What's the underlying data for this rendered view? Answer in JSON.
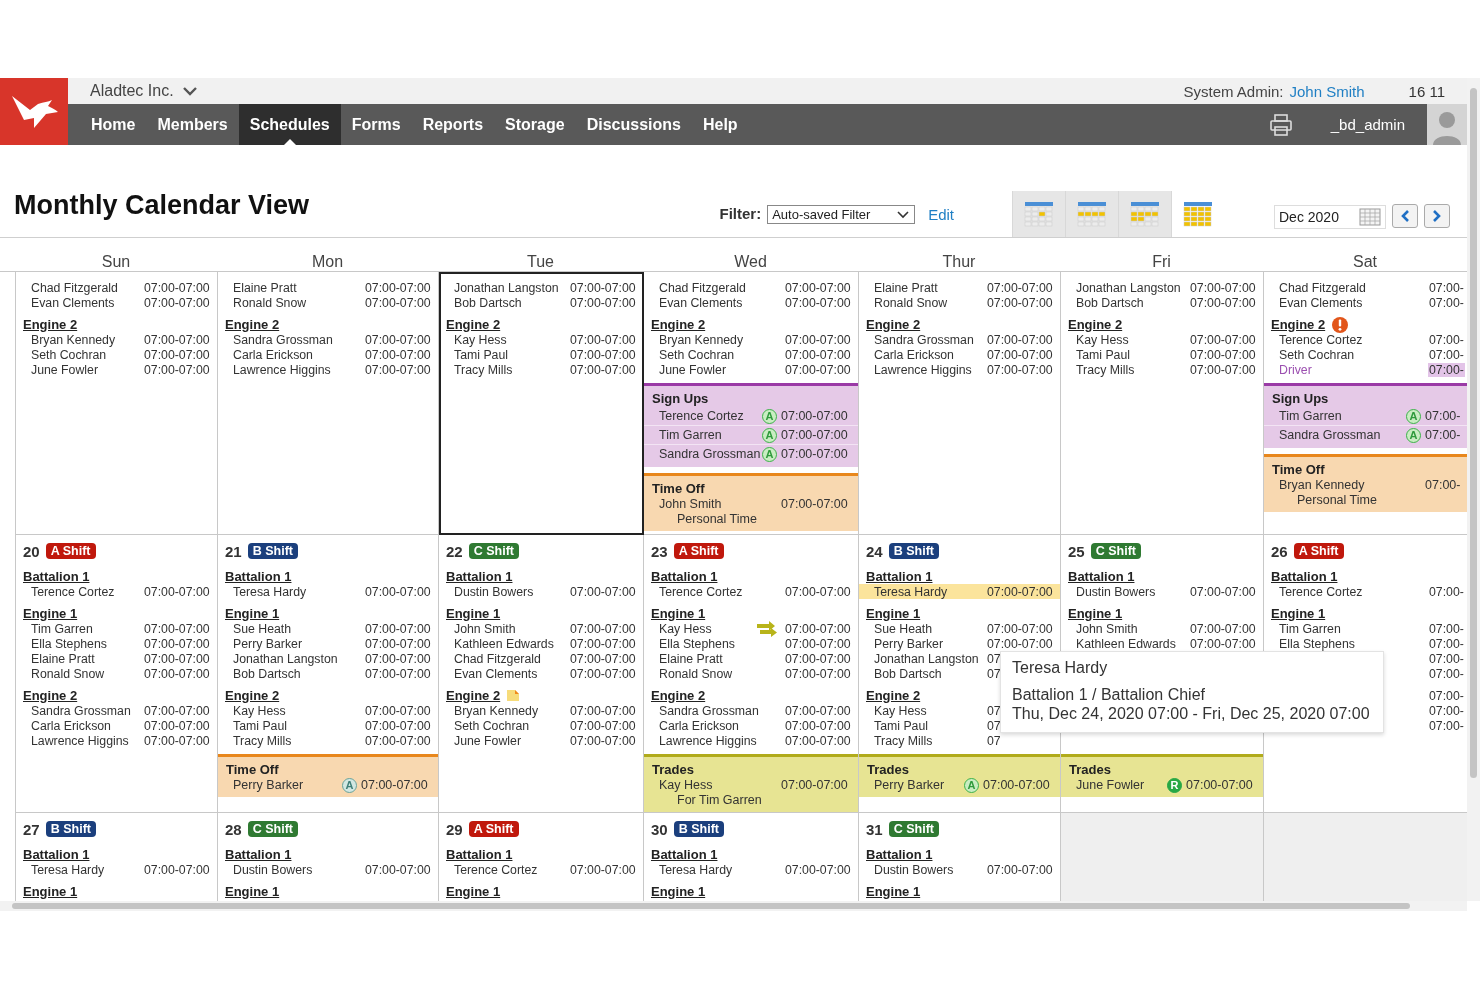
{
  "header": {
    "company": "Aladtec Inc.",
    "role_label": "System Admin:",
    "user_link": "John Smith",
    "counter": "16 11"
  },
  "nav": {
    "items": [
      {
        "label": "Home",
        "selected": false
      },
      {
        "label": "Members",
        "selected": false
      },
      {
        "label": "Schedules",
        "selected": true
      },
      {
        "label": "Forms",
        "selected": false
      },
      {
        "label": "Reports",
        "selected": false
      },
      {
        "label": "Storage",
        "selected": false
      },
      {
        "label": "Discussions",
        "selected": false
      },
      {
        "label": "Help",
        "selected": false
      }
    ],
    "username": "_bd_admin"
  },
  "toolbar": {
    "title": "Monthly Calendar View",
    "filter_label": "Filter:",
    "filter_value": "Auto-saved Filter",
    "edit_link": "Edit",
    "views": [
      {
        "kind": "day",
        "selected": false
      },
      {
        "kind": "week",
        "selected": false
      },
      {
        "kind": "fortnight",
        "selected": false
      },
      {
        "kind": "month",
        "selected": true
      }
    ],
    "month": "Dec 2020"
  },
  "calendar": {
    "weekdays": [
      "Sun",
      "Mon",
      "Tue",
      "Wed",
      "Thur",
      "Fri",
      "Sat"
    ],
    "weeks": [
      {
        "days": [
          {
            "current": false,
            "groups": [
              {
                "kind": "plain",
                "people": [
                  {
                    "name": "Chad Fitzgerald",
                    "time": "07:00-07:00",
                    "kind": "assigned"
                  },
                  {
                    "name": "Evan Clements",
                    "time": "07:00-07:00",
                    "kind": "assigned"
                  }
                ]
              },
              {
                "kind": "plain",
                "title": "Engine 2",
                "people": [
                  {
                    "name": "Bryan Kennedy",
                    "time": "07:00-07:00",
                    "kind": "assigned"
                  },
                  {
                    "name": "Seth Cochran",
                    "time": "07:00-07:00",
                    "kind": "assigned"
                  },
                  {
                    "name": "June Fowler",
                    "time": "07:00-07:00",
                    "kind": "assigned"
                  }
                ]
              }
            ]
          },
          {
            "current": false,
            "groups": [
              {
                "kind": "plain",
                "people": [
                  {
                    "name": "Elaine Pratt",
                    "time": "07:00-07:00",
                    "kind": "assigned"
                  },
                  {
                    "name": "Ronald Snow",
                    "time": "07:00-07:00",
                    "kind": "assigned"
                  }
                ]
              },
              {
                "kind": "plain",
                "title": "Engine 2",
                "people": [
                  {
                    "name": "Sandra Grossman",
                    "time": "07:00-07:00",
                    "kind": "assigned"
                  },
                  {
                    "name": "Carla Erickson",
                    "time": "07:00-07:00",
                    "kind": "assigned"
                  },
                  {
                    "name": "Lawrence Higgins",
                    "time": "07:00-07:00",
                    "kind": "assigned"
                  }
                ]
              }
            ]
          },
          {
            "current": true,
            "groups": [
              {
                "kind": "plain",
                "people": [
                  {
                    "name": "Jonathan Langston",
                    "time": "07:00-07:00",
                    "kind": "assigned"
                  },
                  {
                    "name": "Bob Dartsch",
                    "time": "07:00-07:00",
                    "kind": "assigned"
                  }
                ]
              },
              {
                "kind": "plain",
                "title": "Engine 2",
                "people": [
                  {
                    "name": "Kay Hess",
                    "time": "07:00-07:00",
                    "kind": "assigned"
                  },
                  {
                    "name": "Tami Paul",
                    "time": "07:00-07:00",
                    "kind": "assigned"
                  },
                  {
                    "name": "Tracy Mills",
                    "time": "07:00-07:00",
                    "kind": "assigned"
                  }
                ]
              }
            ]
          },
          {
            "current": false,
            "groups": [
              {
                "kind": "plain",
                "people": [
                  {
                    "name": "Chad Fitzgerald",
                    "time": "07:00-07:00",
                    "kind": "assigned"
                  },
                  {
                    "name": "Evan Clements",
                    "time": "07:00-07:00",
                    "kind": "assigned"
                  }
                ]
              },
              {
                "kind": "plain",
                "title": "Engine 2",
                "people": [
                  {
                    "name": "Bryan Kennedy",
                    "time": "07:00-07:00",
                    "kind": "assigned"
                  },
                  {
                    "name": "Seth Cochran",
                    "time": "07:00-07:00",
                    "kind": "assigned"
                  },
                  {
                    "name": "June Fowler",
                    "time": "07:00-07:00",
                    "kind": "assigned"
                  }
                ]
              }
            ],
            "sections": [
              {
                "kind": "signups",
                "title": "Sign Ups",
                "entries": [
                  {
                    "name": "Terence Cortez",
                    "badge": {
                      "text": "A",
                      "kind": "approved"
                    },
                    "time": "07:00-07:00"
                  },
                  {
                    "name": "Tim Garren",
                    "badge": {
                      "text": "A",
                      "kind": "approved"
                    },
                    "time": "07:00-07:00"
                  },
                  {
                    "name": "Sandra Grossman",
                    "badge": {
                      "text": "A",
                      "kind": "approved"
                    },
                    "time": "07:00-07:00"
                  }
                ]
              },
              {
                "kind": "timeoff",
                "title": "Time Off",
                "entries": [
                  {
                    "name": "John Smith",
                    "time": "07:00-07:00",
                    "note": "Personal Time"
                  }
                ]
              }
            ]
          },
          {
            "current": false,
            "groups": [
              {
                "kind": "plain",
                "people": [
                  {
                    "name": "Elaine Pratt",
                    "time": "07:00-07:00",
                    "kind": "assigned"
                  },
                  {
                    "name": "Ronald Snow",
                    "time": "07:00-07:00",
                    "kind": "assigned"
                  }
                ]
              },
              {
                "kind": "plain",
                "title": "Engine 2",
                "people": [
                  {
                    "name": "Sandra Grossman",
                    "time": "07:00-07:00",
                    "kind": "assigned"
                  },
                  {
                    "name": "Carla Erickson",
                    "time": "07:00-07:00",
                    "kind": "assigned"
                  },
                  {
                    "name": "Lawrence Higgins",
                    "time": "07:00-07:00",
                    "kind": "assigned"
                  }
                ]
              }
            ]
          },
          {
            "current": false,
            "groups": [
              {
                "kind": "plain",
                "people": [
                  {
                    "name": "Jonathan Langston",
                    "time": "07:00-07:00",
                    "kind": "assigned"
                  },
                  {
                    "name": "Bob Dartsch",
                    "time": "07:00-07:00",
                    "kind": "assigned"
                  }
                ]
              },
              {
                "kind": "plain",
                "title": "Engine 2",
                "people": [
                  {
                    "name": "Kay Hess",
                    "time": "07:00-07:00",
                    "kind": "assigned"
                  },
                  {
                    "name": "Tami Paul",
                    "time": "07:00-07:00",
                    "kind": "assigned"
                  },
                  {
                    "name": "Tracy Mills",
                    "time": "07:00-07:00",
                    "kind": "assigned"
                  }
                ]
              }
            ]
          },
          {
            "current": false,
            "groups": [
              {
                "kind": "plain",
                "people": [
                  {
                    "name": "Chad Fitzgerald",
                    "time": "07:00-",
                    "kind": "assigned"
                  },
                  {
                    "name": "Evan Clements",
                    "time": "07:00-",
                    "kind": "assigned"
                  }
                ]
              },
              {
                "kind": "alert",
                "title": "Engine 2",
                "people": [
                  {
                    "name": "Terence Cortez",
                    "time": "07:00-",
                    "kind": "assigned"
                  },
                  {
                    "name": "Seth Cochran",
                    "time": "07:00-",
                    "kind": "assigned"
                  },
                  {
                    "name": "Driver",
                    "time": "07:00-",
                    "kind": "open"
                  }
                ]
              }
            ],
            "sections": [
              {
                "kind": "signups",
                "title": "Sign Ups",
                "entries": [
                  {
                    "name": "Tim Garren",
                    "badge": {
                      "text": "A",
                      "kind": "approved"
                    },
                    "time": "07:00-"
                  },
                  {
                    "name": "Sandra Grossman",
                    "badge": {
                      "text": "A",
                      "kind": "approved"
                    },
                    "time": "07:00-"
                  }
                ]
              },
              {
                "kind": "timeoff",
                "title": "Time Off",
                "entries": [
                  {
                    "name": "Bryan Kennedy",
                    "time": "07:00-",
                    "note": "Personal Time"
                  }
                ]
              }
            ]
          }
        ]
      },
      {
        "days": [
          {
            "current": false,
            "date": "20",
            "shift": {
              "label": "A Shift",
              "color": "#c0180c"
            },
            "groups": [
              {
                "kind": "plain",
                "title": "Battalion 1",
                "people": [
                  {
                    "name": "Terence Cortez",
                    "time": "07:00-07:00",
                    "kind": "assigned"
                  }
                ]
              },
              {
                "kind": "plain",
                "title": "Engine 1",
                "people": [
                  {
                    "name": "Tim Garren",
                    "time": "07:00-07:00",
                    "kind": "assigned"
                  },
                  {
                    "name": "Ella Stephens",
                    "time": "07:00-07:00",
                    "kind": "assigned"
                  },
                  {
                    "name": "Elaine Pratt",
                    "time": "07:00-07:00",
                    "kind": "assigned"
                  },
                  {
                    "name": "Ronald Snow",
                    "time": "07:00-07:00",
                    "kind": "assigned"
                  }
                ]
              },
              {
                "kind": "plain",
                "title": "Engine 2",
                "people": [
                  {
                    "name": "Sandra Grossman",
                    "time": "07:00-07:00",
                    "kind": "assigned"
                  },
                  {
                    "name": "Carla Erickson",
                    "time": "07:00-07:00",
                    "kind": "assigned"
                  },
                  {
                    "name": "Lawrence Higgins",
                    "time": "07:00-07:00",
                    "kind": "assigned"
                  }
                ]
              }
            ]
          },
          {
            "current": false,
            "date": "21",
            "shift": {
              "label": "B Shift",
              "color": "#1b3f7d"
            },
            "groups": [
              {
                "kind": "plain",
                "title": "Battalion 1",
                "people": [
                  {
                    "name": "Teresa Hardy",
                    "time": "07:00-07:00",
                    "kind": "assigned"
                  }
                ]
              },
              {
                "kind": "plain",
                "title": "Engine 1",
                "people": [
                  {
                    "name": "Sue Heath",
                    "time": "07:00-07:00",
                    "kind": "assigned"
                  },
                  {
                    "name": "Perry Barker",
                    "time": "07:00-07:00",
                    "kind": "assigned"
                  },
                  {
                    "name": "Jonathan Langston",
                    "time": "07:00-07:00",
                    "kind": "assigned"
                  },
                  {
                    "name": "Bob Dartsch",
                    "time": "07:00-07:00",
                    "kind": "assigned"
                  }
                ]
              },
              {
                "kind": "plain",
                "title": "Engine 2",
                "people": [
                  {
                    "name": "Kay Hess",
                    "time": "07:00-07:00",
                    "kind": "assigned"
                  },
                  {
                    "name": "Tami Paul",
                    "time": "07:00-07:00",
                    "kind": "assigned"
                  },
                  {
                    "name": "Tracy Mills",
                    "time": "07:00-07:00",
                    "kind": "assigned"
                  }
                ]
              }
            ],
            "sections": [
              {
                "kind": "timeoff",
                "title": "Time Off",
                "entries": [
                  {
                    "name": "Perry Barker",
                    "badge": {
                      "text": "A",
                      "kind": "faded"
                    },
                    "time": "07:00-07:00"
                  }
                ]
              }
            ]
          },
          {
            "current": false,
            "date": "22",
            "shift": {
              "label": "C Shift",
              "color": "#2f7a32"
            },
            "groups": [
              {
                "kind": "plain",
                "title": "Battalion 1",
                "people": [
                  {
                    "name": "Dustin Bowers",
                    "time": "07:00-07:00",
                    "kind": "assigned"
                  }
                ]
              },
              {
                "kind": "plain",
                "title": "Engine 1",
                "people": [
                  {
                    "name": "John Smith",
                    "time": "07:00-07:00",
                    "kind": "assigned"
                  },
                  {
                    "name": "Kathleen Edwards",
                    "time": "07:00-07:00",
                    "kind": "assigned"
                  },
                  {
                    "name": "Chad Fitzgerald",
                    "time": "07:00-07:00",
                    "kind": "assigned"
                  },
                  {
                    "name": "Evan Clements",
                    "time": "07:00-07:00",
                    "kind": "assigned"
                  }
                ]
              },
              {
                "kind": "note",
                "title": "Engine 2",
                "people": [
                  {
                    "name": "Bryan Kennedy",
                    "time": "07:00-07:00",
                    "kind": "assigned"
                  },
                  {
                    "name": "Seth Cochran",
                    "time": "07:00-07:00",
                    "kind": "assigned"
                  },
                  {
                    "name": "June Fowler",
                    "time": "07:00-07:00",
                    "kind": "assigned"
                  }
                ]
              }
            ]
          },
          {
            "current": false,
            "date": "23",
            "shift": {
              "label": "A Shift",
              "color": "#c0180c"
            },
            "groups": [
              {
                "kind": "plain",
                "title": "Battalion 1",
                "people": [
                  {
                    "name": "Terence Cortez",
                    "time": "07:00-07:00",
                    "kind": "assigned"
                  }
                ]
              },
              {
                "kind": "plain",
                "title": "Engine 1",
                "people": [
                  {
                    "name": "Kay Hess",
                    "time": "07:00-07:00",
                    "kind": "traded"
                  },
                  {
                    "name": "Ella Stephens",
                    "time": "07:00-07:00",
                    "kind": "assigned"
                  },
                  {
                    "name": "Elaine Pratt",
                    "time": "07:00-07:00",
                    "kind": "assigned"
                  },
                  {
                    "name": "Ronald Snow",
                    "time": "07:00-07:00",
                    "kind": "assigned"
                  }
                ]
              },
              {
                "kind": "plain",
                "title": "Engine 2",
                "people": [
                  {
                    "name": "Sandra Grossman",
                    "time": "07:00-07:00",
                    "kind": "assigned"
                  },
                  {
                    "name": "Carla Erickson",
                    "time": "07:00-07:00",
                    "kind": "assigned"
                  },
                  {
                    "name": "Lawrence Higgins",
                    "time": "07:00-07:00",
                    "kind": "assigned"
                  }
                ]
              }
            ],
            "sections": [
              {
                "kind": "trades",
                "title": "Trades",
                "entries": [
                  {
                    "name": "Kay Hess",
                    "time": "07:00-07:00",
                    "note": "For Tim Garren"
                  }
                ]
              }
            ]
          },
          {
            "current": false,
            "date": "24",
            "shift": {
              "label": "B Shift",
              "color": "#1b3f7d"
            },
            "groups": [
              {
                "kind": "plain",
                "title": "Battalion 1",
                "people": [
                  {
                    "name": "Teresa Hardy",
                    "time": "07:00-07:00",
                    "kind": "hovered"
                  }
                ]
              },
              {
                "kind": "plain",
                "title": "Engine 1",
                "people": [
                  {
                    "name": "Sue Heath",
                    "time": "07:00-07:00",
                    "kind": "assigned"
                  },
                  {
                    "name": "Perry Barker",
                    "time": "07:00-07:00",
                    "kind": "assigned"
                  },
                  {
                    "name": "Jonathan Langston",
                    "time": "07",
                    "kind": "assigned"
                  },
                  {
                    "name": "Bob Dartsch",
                    "time": "07",
                    "kind": "assigned"
                  }
                ]
              },
              {
                "kind": "plain",
                "title": "Engine 2",
                "people": [
                  {
                    "name": "Kay Hess",
                    "time": "07",
                    "kind": "assigned"
                  },
                  {
                    "name": "Tami Paul",
                    "time": "07",
                    "kind": "assigned"
                  },
                  {
                    "name": "Tracy Mills",
                    "time": "07",
                    "kind": "assigned"
                  }
                ]
              }
            ],
            "sections": [
              {
                "kind": "trades",
                "title": "Trades",
                "entries": [
                  {
                    "name": "Perry Barker",
                    "badge": {
                      "text": "A",
                      "kind": "approved"
                    },
                    "time": "07:00-07:00"
                  }
                ]
              }
            ]
          },
          {
            "current": false,
            "date": "25",
            "shift": {
              "label": "C Shift",
              "color": "#2f7a32"
            },
            "groups": [
              {
                "kind": "plain",
                "title": "Battalion 1",
                "people": [
                  {
                    "name": "Dustin Bowers",
                    "time": "07:00-07:00",
                    "kind": "assigned"
                  }
                ]
              },
              {
                "kind": "plain",
                "title": "Engine 1",
                "people": [
                  {
                    "name": "John Smith",
                    "time": "07:00-07:00",
                    "kind": "assigned"
                  },
                  {
                    "name": "Kathleen Edwards",
                    "time": "07:00-07:00",
                    "kind": "assigned"
                  }
                ]
              }
            ],
            "sections": [
              {
                "kind": "trades",
                "title": "Trades",
                "entries": [
                  {
                    "name": "June Fowler",
                    "badge": {
                      "text": "R",
                      "kind": "filled"
                    },
                    "time": "07:00-07:00"
                  }
                ]
              }
            ]
          },
          {
            "current": false,
            "date": "26",
            "shift": {
              "label": "A Shift",
              "color": "#c0180c"
            },
            "groups": [
              {
                "kind": "plain",
                "title": "Battalion 1",
                "people": [
                  {
                    "name": "Terence Cortez",
                    "time": "07:00-",
                    "kind": "assigned"
                  }
                ]
              },
              {
                "kind": "plain",
                "title": "Engine 1",
                "people": [
                  {
                    "name": "Tim Garren",
                    "time": "07:00-",
                    "kind": "assigned"
                  },
                  {
                    "name": "Ella Stephens",
                    "time": "07:00-",
                    "kind": "assigned"
                  },
                  {
                    "time": "07:00-",
                    "kind": "assigned"
                  },
                  {
                    "time": "07:00-",
                    "kind": "assigned"
                  }
                ]
              },
              {
                "kind": "plain",
                "people": [
                  {
                    "time": "07:00-",
                    "kind": "assigned"
                  },
                  {
                    "time": "07:00-",
                    "kind": "assigned"
                  },
                  {
                    "time": "07:00-",
                    "kind": "assigned"
                  }
                ]
              }
            ]
          }
        ]
      },
      {
        "days": [
          {
            "current": false,
            "date": "27",
            "shift": {
              "label": "B Shift",
              "color": "#1b3f7d"
            },
            "groups": [
              {
                "kind": "plain",
                "title": "Battalion 1",
                "people": [
                  {
                    "name": "Teresa Hardy",
                    "time": "07:00-07:00",
                    "kind": "assigned"
                  }
                ]
              },
              {
                "kind": "plain",
                "title": "Engine 1"
              }
            ]
          },
          {
            "current": false,
            "date": "28",
            "shift": {
              "label": "C Shift",
              "color": "#2f7a32"
            },
            "groups": [
              {
                "kind": "plain",
                "title": "Battalion 1",
                "people": [
                  {
                    "name": "Dustin Bowers",
                    "time": "07:00-07:00",
                    "kind": "assigned"
                  }
                ]
              },
              {
                "kind": "plain",
                "title": "Engine 1"
              }
            ]
          },
          {
            "current": false,
            "date": "29",
            "shift": {
              "label": "A Shift",
              "color": "#c0180c"
            },
            "groups": [
              {
                "kind": "plain",
                "title": "Battalion 1",
                "people": [
                  {
                    "name": "Terence Cortez",
                    "time": "07:00-07:00",
                    "kind": "assigned"
                  }
                ]
              },
              {
                "kind": "plain",
                "title": "Engine 1"
              }
            ]
          },
          {
            "current": false,
            "date": "30",
            "shift": {
              "label": "B Shift",
              "color": "#1b3f7d"
            },
            "groups": [
              {
                "kind": "plain",
                "title": "Battalion 1",
                "people": [
                  {
                    "name": "Teresa Hardy",
                    "time": "07:00-07:00",
                    "kind": "assigned"
                  }
                ]
              },
              {
                "kind": "plain",
                "title": "Engine 1"
              }
            ]
          },
          {
            "current": false,
            "date": "31",
            "shift": {
              "label": "C Shift",
              "color": "#2f7a32"
            },
            "groups": [
              {
                "kind": "plain",
                "title": "Battalion 1",
                "people": [
                  {
                    "name": "Dustin Bowers",
                    "time": "07:00-07:00",
                    "kind": "assigned"
                  }
                ]
              },
              {
                "kind": "plain",
                "title": "Engine 1"
              }
            ]
          }
        ]
      }
    ]
  },
  "tooltip": {
    "title": "Teresa Hardy",
    "line_1": "Battalion 1 / Battalion Chief",
    "line_2": "Thu, Dec 24, 2020 07:00 - Fri, Dec 25, 2020 07:00"
  }
}
